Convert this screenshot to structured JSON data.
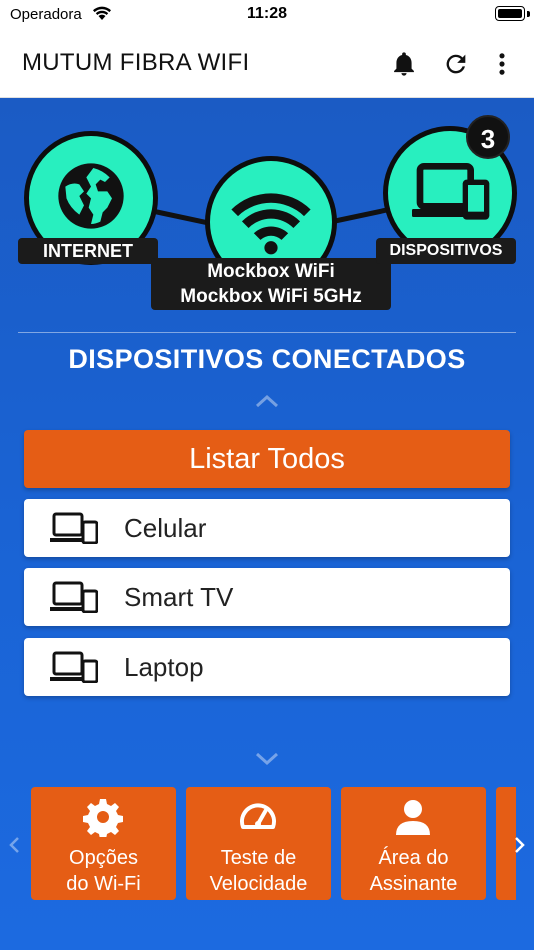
{
  "status_bar": {
    "carrier": "Operadora",
    "time": "11:28"
  },
  "header": {
    "title": "MUTUM FIBRA WIFI"
  },
  "network_map": {
    "internet_label": "INTERNET",
    "router_ssid_1": "Mockbox WiFi",
    "router_ssid_2": "Mockbox WiFi 5GHz",
    "devices_label": "DISPOSITIVOS",
    "devices_count": "3"
  },
  "section": {
    "title": "DISPOSITIVOS CONECTADOS"
  },
  "list_all_button": "Listar Todos",
  "devices": [
    {
      "name": "Celular"
    },
    {
      "name": "Smart TV"
    },
    {
      "name": "Laptop"
    }
  ],
  "actions": [
    {
      "line1": "Opções",
      "line2": "do Wi-Fi",
      "icon": "gear-icon"
    },
    {
      "line1": "Teste de",
      "line2": "Velocidade",
      "icon": "speedometer-icon"
    },
    {
      "line1": "Área do",
      "line2": "Assinante",
      "icon": "user-icon"
    }
  ],
  "colors": {
    "background_gradient_top": "#1b5bc4",
    "node_fill": "#28efbf",
    "accent_orange": "#e55d15",
    "label_dark": "#1b1b1b"
  }
}
